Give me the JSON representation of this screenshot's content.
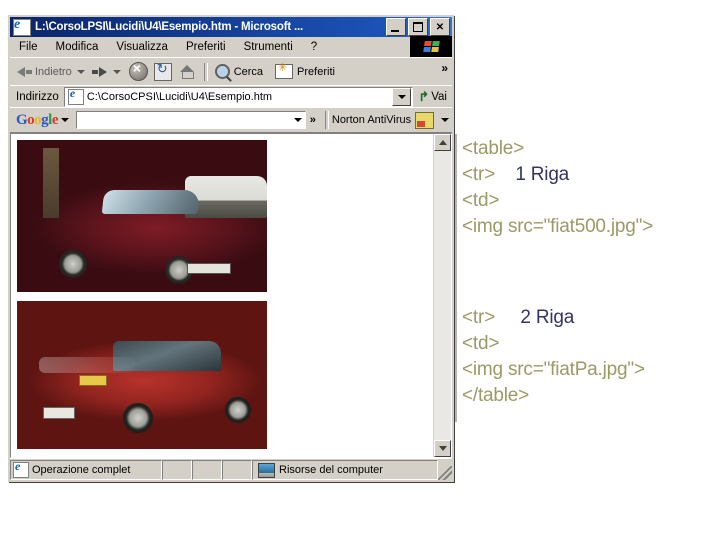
{
  "window": {
    "title": "L:\\CorsoLPSI\\Lucidi\\U4\\Esempio.htm - Microsoft ...",
    "app_icon": "ie-document-icon",
    "controls": {
      "minimize": "_",
      "maximize": "□",
      "close": "✕"
    }
  },
  "menu": {
    "items": [
      {
        "label": "File"
      },
      {
        "label": "Modifica"
      },
      {
        "label": "Visualizza"
      },
      {
        "label": "Preferiti"
      },
      {
        "label": "Strumenti"
      },
      {
        "label": "?"
      }
    ]
  },
  "toolbar": {
    "back_label": "Indietro",
    "forward_label": "",
    "stop_label": "",
    "refresh_label": "",
    "home_label": "",
    "search_label": "Cerca",
    "favorites_label": "Preferiti",
    "overflow_label": "»"
  },
  "address": {
    "label": "Indirizzo",
    "value": "C:\\CorsoCPSI\\Lucidi\\U4\\Esempio.htm",
    "placeholder": "",
    "go_label": "Vai",
    "go_arrow": "↱"
  },
  "google_toolbar": {
    "logo_parts": [
      {
        "t": "G",
        "c": "gb"
      },
      {
        "t": "o",
        "c": "gr"
      },
      {
        "t": "o",
        "c": "gy"
      },
      {
        "t": "g",
        "c": "gb"
      },
      {
        "t": "l",
        "c": "gg"
      },
      {
        "t": "e",
        "c": "gr"
      }
    ],
    "logo_text": "Google",
    "search_value": "",
    "search_placeholder": "",
    "overflow_label": "»",
    "norton_label": "Norton AntiVirus"
  },
  "page": {
    "images": [
      {
        "name": "fiat500-photo",
        "alt": "fiat500.jpg"
      },
      {
        "name": "fiatPa-photo",
        "alt": "fiatPa.jpg"
      }
    ]
  },
  "status_bar": {
    "status_text": "Operazione complet",
    "zone_text": "Risorse del computer"
  },
  "code": {
    "block1": [
      {
        "tag": "<table>",
        "note": ""
      },
      {
        "tag": "<tr>",
        "note": "1 Riga"
      },
      {
        "tag": "<td>",
        "note": ""
      },
      {
        "tag": "<img src=\"fiat500.jpg\">",
        "note": ""
      }
    ],
    "block2": [
      {
        "tag": "<tr>",
        "note": "2 Riga"
      },
      {
        "tag": "<td>",
        "note": ""
      },
      {
        "tag": "<img src=\"fiatPa.jpg\">",
        "note": ""
      },
      {
        "tag": "</table>",
        "note": ""
      }
    ]
  },
  "colors": {
    "code_tag": "#9a9a66",
    "code_note": "#333366",
    "titlebar": "#0a246a",
    "chrome": "#d4d0c8"
  }
}
